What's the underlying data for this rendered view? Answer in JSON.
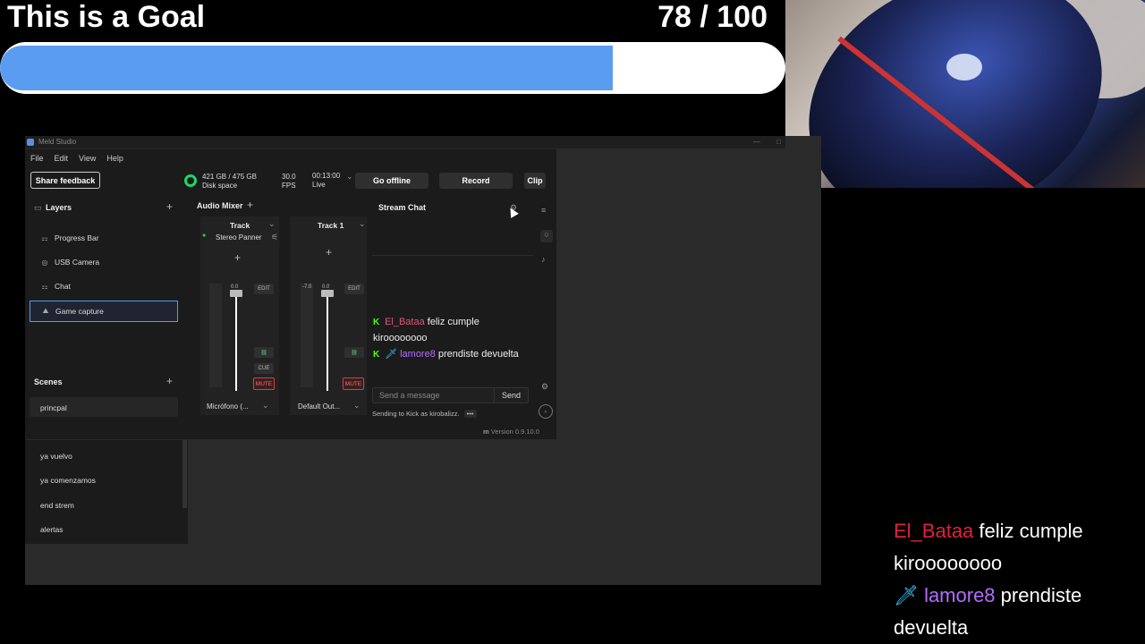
{
  "goal": {
    "title": "This is a Goal",
    "count_label": "78 / 100",
    "current": 78,
    "target": 100,
    "fill_color": "#5a9cf2"
  },
  "window": {
    "app_name": "Meld Studio",
    "menu": [
      "File",
      "Edit",
      "View",
      "Help"
    ]
  },
  "toolbar": {
    "feedback_label": "Share feedback",
    "disk_value": "421 GB / 475 GB",
    "disk_label": "Disk space",
    "fps_value": "30.0",
    "fps_label": "FPS",
    "time_value": "00:13:00",
    "time_label": "Live",
    "offline_label": "Go offline",
    "record_label": "Record",
    "clip_label": "Clip",
    "disk_ring_color": "#1ed66a"
  },
  "layers": {
    "title": "Layers",
    "items": [
      {
        "label": "Progress Bar",
        "icon": "group-icon"
      },
      {
        "label": "USB Camera",
        "icon": "camera-icon"
      },
      {
        "label": "Chat",
        "icon": "group-icon"
      },
      {
        "label": "Game capture",
        "icon": "capture-icon"
      }
    ],
    "selected": "Game capture"
  },
  "scenes": {
    "title": "Scenes",
    "items": [
      "princpal",
      "ya vuelvo",
      "ya comenzamos",
      "end strem",
      "alertas"
    ]
  },
  "mixer": {
    "title": "Audio Mixer",
    "tracks": [
      {
        "name": "Track",
        "effect": "Stereo Panner",
        "level": "0.0",
        "edit": "EDIT",
        "cue": "CUE",
        "mute": "MUTE",
        "device": "Micrófono (..."
      },
      {
        "name": "Track 1",
        "level": "0.0",
        "peak": "-7.0",
        "edit": "EDIT",
        "mute": "MUTE",
        "device": "Default Out..."
      }
    ]
  },
  "stream_chat": {
    "title": "Stream Chat",
    "messages": [
      {
        "user": "El_Bataa",
        "text": "feliz cumple kiroooooooo",
        "badge": "kick-icon",
        "user_color": "#e0567a"
      },
      {
        "user": "lamore8",
        "text": "prendiste devuelta",
        "badge": "sword-icon",
        "user_color": "#b46cff"
      }
    ],
    "input_placeholder": "Send a message",
    "send_label": "Send",
    "sending_as": "Sending to Kick as kirobalizz.",
    "more_label": "•••"
  },
  "version": "Version 0.9.10.0",
  "overlay_chat": {
    "messages": [
      {
        "user": "El_Bataa",
        "text": "feliz cumple",
        "cont": "kiroooooooo",
        "user_color": "#e0203f"
      },
      {
        "user": "lamore8",
        "text": "prendiste",
        "cont": "devuelta",
        "badge": "sword-icon",
        "user_color": "#b46cff"
      }
    ]
  }
}
